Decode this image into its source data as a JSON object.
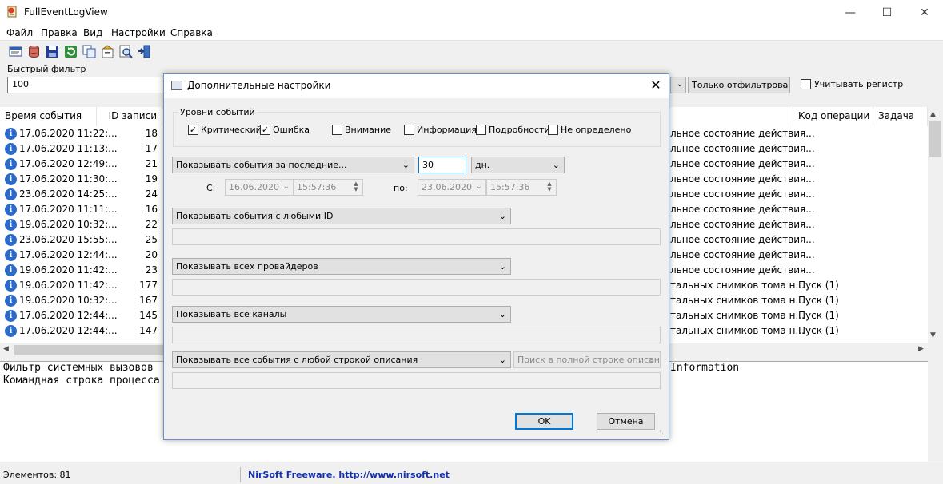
{
  "window": {
    "title": "FullEventLogView"
  },
  "menu": [
    "Файл",
    "Правка",
    "Вид",
    "Настройки",
    "Справка"
  ],
  "toolbar": [
    "properties-icon",
    "database-icon",
    "save-icon",
    "refresh-icon",
    "copy-icon",
    "html-report-icon",
    "find-icon",
    "exit-icon"
  ],
  "quick_filter": {
    "label": "Быстрый фильтр",
    "value": "100",
    "mode": "Только отфильтрова",
    "case_label": "Учитывать регистр"
  },
  "columns": {
    "time": "Время события",
    "id": "ID записи",
    "opcode": "Код операции",
    "task": "Задача"
  },
  "rows": [
    {
      "time": "17.06.2020 11:22:...",
      "id": "18",
      "state": "льное состояние действия...",
      "task": ""
    },
    {
      "time": "17.06.2020 11:13:...",
      "id": "17",
      "state": "льное состояние действия...",
      "task": ""
    },
    {
      "time": "17.06.2020 12:49:...",
      "id": "21",
      "state": "льное состояние действия...",
      "task": ""
    },
    {
      "time": "17.06.2020 11:30:...",
      "id": "19",
      "state": "льное состояние действия...",
      "task": ""
    },
    {
      "time": "23.06.2020 14:25:...",
      "id": "24",
      "state": "льное состояние действия...",
      "task": ""
    },
    {
      "time": "17.06.2020 11:11:...",
      "id": "16",
      "state": "льное состояние действия...",
      "task": ""
    },
    {
      "time": "19.06.2020 10:32:...",
      "id": "22",
      "state": "льное состояние действия...",
      "task": ""
    },
    {
      "time": "23.06.2020 15:55:...",
      "id": "25",
      "state": "льное состояние действия...",
      "task": ""
    },
    {
      "time": "17.06.2020 12:44:...",
      "id": "20",
      "state": "льное состояние действия...",
      "task": ""
    },
    {
      "time": "19.06.2020 11:42:...",
      "id": "23",
      "state": "льное состояние действия...",
      "task": ""
    },
    {
      "time": "19.06.2020 11:42:...",
      "id": "177",
      "state": "тальных снимков тома н...",
      "task": "Пуск (1)"
    },
    {
      "time": "19.06.2020 10:32:...",
      "id": "167",
      "state": "тальных снимков тома н...",
      "task": "Пуск (1)"
    },
    {
      "time": "17.06.2020 12:44:...",
      "id": "145",
      "state": "тальных снимков тома н...",
      "task": "Пуск (1)"
    },
    {
      "time": "17.06.2020 12:44:...",
      "id": "147",
      "state": "тальных снимков тома н...",
      "task": "Пуск (1)"
    }
  ],
  "lower_pane": {
    "line1": "Фильтр системных вызовов",
    "line2": "Командная строка процесса",
    "right_text": "Information"
  },
  "status": {
    "count": "Элементов: 81",
    "link": "NirSoft Freeware.  http://www.nirsoft.net"
  },
  "dialog": {
    "title": "Дополнительные настройки",
    "levels_title": "Уровни событий",
    "levels": [
      {
        "label": "Критический",
        "checked": true
      },
      {
        "label": "Ошибка",
        "checked": true
      },
      {
        "label": "Внимание",
        "checked": false
      },
      {
        "label": "Информация",
        "checked": false
      },
      {
        "label": "Подробности",
        "checked": false
      },
      {
        "label": "Не определено",
        "checked": false
      }
    ],
    "time_mode": "Показывать события за последние...",
    "time_value": "30",
    "time_unit": "дн.",
    "from_label": "С:",
    "from_date": "16.06.2020",
    "from_time": "15:57:36",
    "to_label": "по:",
    "to_date": "23.06.2020",
    "to_time": "15:57:36",
    "ids_mode": "Показывать события с любыми ID",
    "providers_mode": "Показывать всех провайдеров",
    "channels_mode": "Показывать все каналы",
    "desc_mode": "Показывать все события с любой строкой описания",
    "desc_search": "Поиск в полной строке описани",
    "ok": "OK",
    "cancel": "Отмена"
  }
}
